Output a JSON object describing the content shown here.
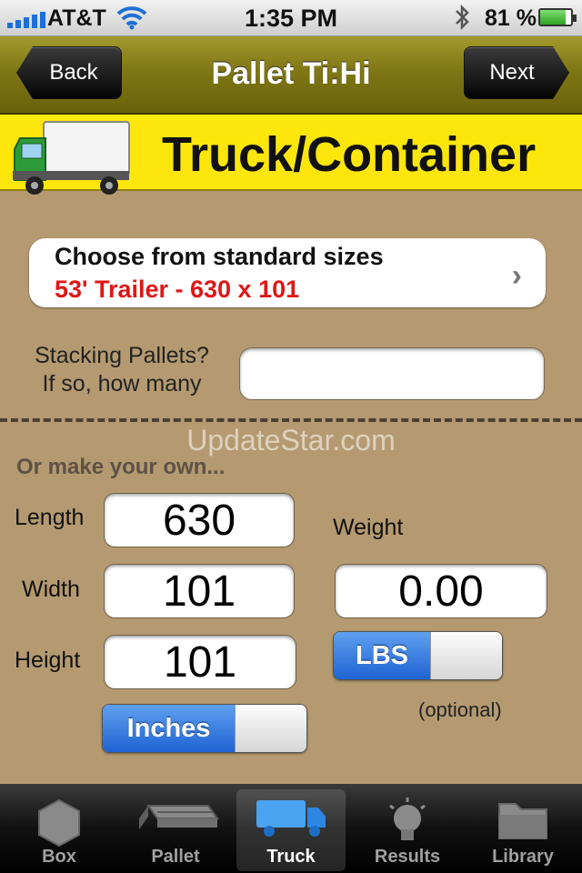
{
  "status_bar": {
    "carrier": "AT&T",
    "time": "1:35 PM",
    "battery_percent": "81 %",
    "battery_level": 0.81
  },
  "navbar": {
    "back_label": "Back",
    "title": "Pallet Ti:Hi",
    "next_label": "Next"
  },
  "header": {
    "title": "Truck/Container"
  },
  "standard_sizes": {
    "title": "Choose from standard sizes",
    "selected": "53' Trailer - 630 x 101"
  },
  "stacking": {
    "label_line1": "Stacking Pallets?",
    "label_line2": "If so, how many",
    "value": ""
  },
  "watermark": "UpdateStar.com",
  "custom": {
    "section_label": "Or make your own...",
    "length_label": "Length",
    "length_value": "630",
    "width_label": "Width",
    "width_value": "101",
    "height_label": "Height",
    "height_value": "101",
    "weight_label": "Weight",
    "weight_value": "0.00",
    "weight_unit": "LBS",
    "dimension_unit": "Inches",
    "optional_note": "(optional)"
  },
  "tabs": [
    {
      "label": "Box",
      "icon": "hexagon-box-icon",
      "active": false
    },
    {
      "label": "Pallet",
      "icon": "pallet-icon",
      "active": false
    },
    {
      "label": "Truck",
      "icon": "truck-icon",
      "active": true
    },
    {
      "label": "Results",
      "icon": "lightbulb-icon",
      "active": false
    },
    {
      "label": "Library",
      "icon": "folder-icon",
      "active": false
    }
  ],
  "colors": {
    "navbar": "#7f7614",
    "header_yellow": "#fde60c",
    "background": "#b59a71",
    "accent_red": "#e01616",
    "toggle_blue": "#1f63d3"
  }
}
